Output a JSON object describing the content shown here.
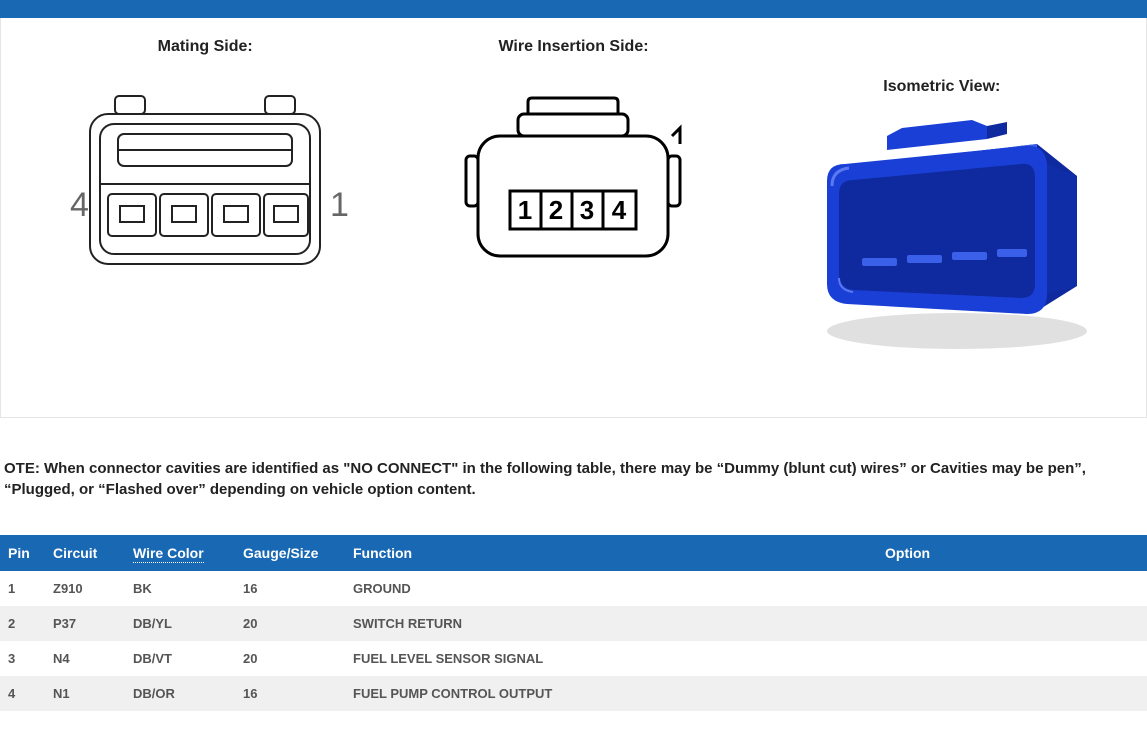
{
  "views": {
    "mating": "Mating Side:",
    "insertion": "Wire Insertion Side:",
    "isometric": "Isometric View:"
  },
  "mating_labels": {
    "left": "4",
    "right": "1"
  },
  "insertion_labels": [
    "1",
    "2",
    "3",
    "4"
  ],
  "note": "OTE: When connector cavities are identified as \"NO CONNECT\" in the following table, there may be “Dummy (blunt cut) wires” or Cavities may be pen”, “Plugged, or “Flashed over” depending on vehicle option content.",
  "table": {
    "headers": {
      "pin": "Pin",
      "circuit": "Circuit",
      "wire_color": "Wire Color",
      "gauge": "Gauge/Size",
      "function": "Function",
      "option": "Option"
    },
    "rows": [
      {
        "pin": "1",
        "circuit": "Z910",
        "wire_color": "BK",
        "gauge": "16",
        "function": "GROUND",
        "option": ""
      },
      {
        "pin": "2",
        "circuit": "P37",
        "wire_color": "DB/YL",
        "gauge": "20",
        "function": "SWITCH RETURN",
        "option": ""
      },
      {
        "pin": "3",
        "circuit": "N4",
        "wire_color": "DB/VT",
        "gauge": "20",
        "function": "FUEL LEVEL SENSOR SIGNAL",
        "option": ""
      },
      {
        "pin": "4",
        "circuit": "N1",
        "wire_color": "DB/OR",
        "gauge": "16",
        "function": "FUEL PUMP CONTROL OUTPUT",
        "option": ""
      }
    ]
  },
  "colors": {
    "brand": "#1968b3",
    "connector_blue": "#1a3fd6",
    "connector_blue_dark": "#0f2a9e",
    "connector_blue_light": "#3a5fe8"
  }
}
